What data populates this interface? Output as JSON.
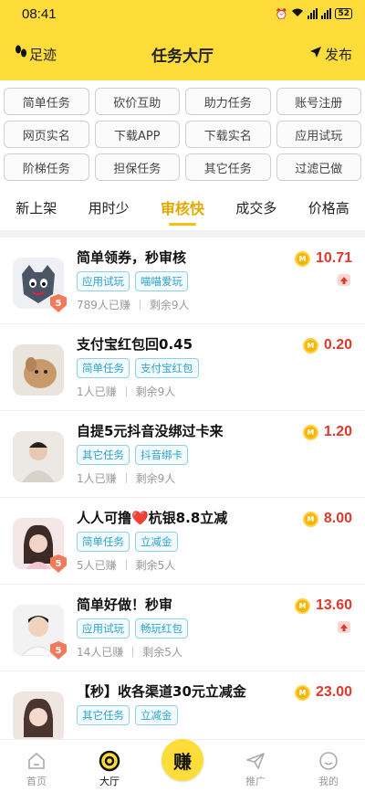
{
  "status": {
    "time": "08:41",
    "battery": "52"
  },
  "nav": {
    "left_label": "足迹",
    "title": "任务大厅",
    "right_label": "发布"
  },
  "categories": [
    "简单任务",
    "砍价互助",
    "助力任务",
    "账号注册",
    "网页实名",
    "下载APP",
    "下载实名",
    "应用试玩",
    "阶梯任务",
    "担保任务",
    "其它任务",
    "过滤已做"
  ],
  "sort_tabs": [
    "新上架",
    "用时少",
    "审核快",
    "成交多",
    "价格高"
  ],
  "active_sort": "审核快",
  "tasks": [
    {
      "title": "简单领券，秒审核",
      "tags": [
        "应用试玩",
        "喵喵爱玩"
      ],
      "earned": "789人已赚",
      "remaining": "剩余9人",
      "price": "10.71",
      "pinned": true,
      "badge": "5"
    },
    {
      "title": "支付宝红包回0.45",
      "tags": [
        "简单任务",
        "支付宝红包"
      ],
      "earned": "1人已赚",
      "remaining": "剩余9人",
      "price": "0.20",
      "pinned": false,
      "badge": ""
    },
    {
      "title": "自提5元抖音没绑过卡来",
      "tags": [
        "其它任务",
        "抖音绑卡"
      ],
      "earned": "1人已赚",
      "remaining": "剩余9人",
      "price": "1.20",
      "pinned": false,
      "badge": ""
    },
    {
      "title": "人人可撸❤️杭银8.8立减",
      "tags": [
        "简单任务",
        "立减金"
      ],
      "earned": "5人已赚",
      "remaining": "剩余5人",
      "price": "8.00",
      "pinned": false,
      "badge": "5"
    },
    {
      "title": "简单好做！秒审",
      "tags": [
        "应用试玩",
        "畅玩红包"
      ],
      "earned": "14人已赚",
      "remaining": "剩余5人",
      "price": "13.60",
      "pinned": true,
      "badge": "5"
    },
    {
      "title": "【秒】收各渠道30元立减金",
      "tags": [
        "其它任务",
        "立减金"
      ],
      "earned": "",
      "remaining": "",
      "price": "23.00",
      "pinned": false,
      "badge": ""
    }
  ],
  "bottom_nav": {
    "home": "首页",
    "hall": "大厅",
    "earn": "赚",
    "promote": "推广",
    "mine": "我的"
  },
  "colors": {
    "brand_yellow": "#fedd3a",
    "price_red": "#e0382c",
    "tag_blue": "#2aa3cf"
  }
}
